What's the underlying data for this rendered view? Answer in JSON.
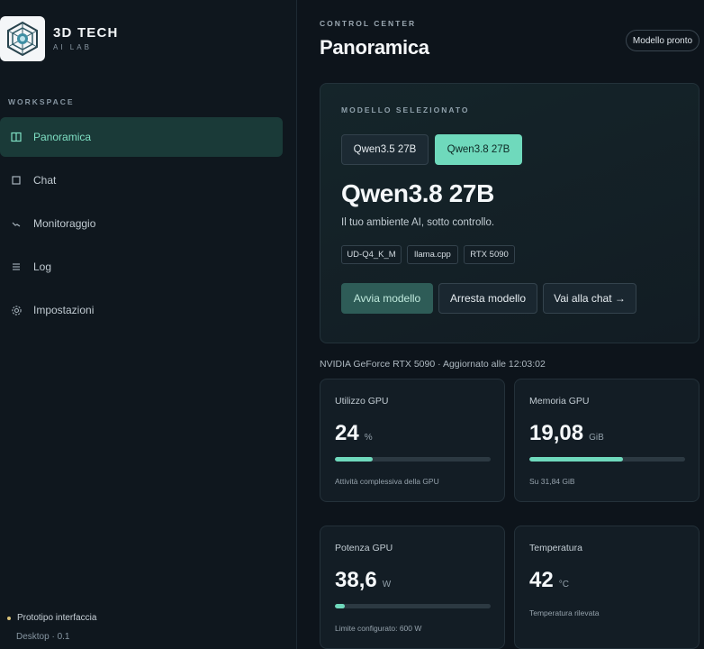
{
  "brand": {
    "title": "3D TECH",
    "subtitle": "AI LAB"
  },
  "sidebar": {
    "section_label": "WORKSPACE",
    "items": [
      {
        "label": "Panoramica",
        "icon": "columns-icon",
        "active": true
      },
      {
        "label": "Chat",
        "icon": "square-icon",
        "active": false
      },
      {
        "label": "Monitoraggio",
        "icon": "activity-icon",
        "active": false
      },
      {
        "label": "Log",
        "icon": "list-icon",
        "active": false
      },
      {
        "label": "Impostazioni",
        "icon": "gear-icon",
        "active": false
      }
    ],
    "footer_status": "Prototipo interfaccia",
    "footer_version": "Desktop · 0.1"
  },
  "header": {
    "eyebrow": "CONTROL CENTER",
    "title": "Panoramica",
    "status_pill": "Modello pronto"
  },
  "model_card": {
    "label": "MODELLO SELEZIONATO",
    "tabs": [
      {
        "label": "Qwen3.5 27B",
        "selected": false
      },
      {
        "label": "Qwen3.8 27B",
        "selected": true
      }
    ],
    "model_name": "Qwen3.8 27B",
    "description": "Il tuo ambiente AI, sotto controllo.",
    "chips": [
      "UD-Q4_K_M",
      "llama.cpp",
      "RTX 5090"
    ],
    "actions": {
      "start": "Avvia modello",
      "stop": "Arresta modello",
      "chat": "Vai alla chat →"
    }
  },
  "gpu_caption": "NVIDIA GeForce RTX 5090 · Aggiornato alle 12:03:02",
  "stats": [
    {
      "title": "Utilizzo GPU",
      "value": "24",
      "unit": "%",
      "fill": 0.24,
      "note": "Attività complessiva della GPU"
    },
    {
      "title": "Memoria GPU",
      "value": "19,08",
      "unit": "GiB",
      "fill": 0.6,
      "note": "Su 31,84 GiB"
    },
    {
      "title": "Potenza GPU",
      "value": "38,6",
      "unit": "W",
      "fill": 0.064,
      "note": "Limite configurato: 600 W"
    },
    {
      "title": "Temperatura",
      "value": "42",
      "unit": "°C",
      "fill": null,
      "note": "Temperatura rilevata"
    }
  ],
  "colors": {
    "accent": "#6fd9bc",
    "background": "#0d141b",
    "status_dot": "#d9c27a"
  }
}
